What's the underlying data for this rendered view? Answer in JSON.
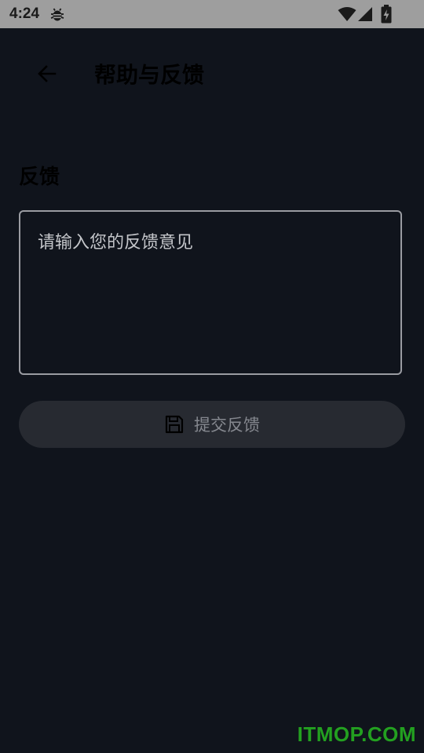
{
  "status_bar": {
    "time": "4:24",
    "icons": [
      "bug-icon",
      "wifi-icon",
      "signal-icon",
      "battery-charging-icon"
    ]
  },
  "app_bar": {
    "back_icon": "arrow-left-icon",
    "title": "帮助与反馈"
  },
  "feedback": {
    "section_title": "反馈",
    "placeholder": "请输入您的反馈意见",
    "value": ""
  },
  "submit": {
    "icon": "save-icon",
    "label": "提交反馈"
  },
  "watermark": "ITMOP.COM",
  "colors": {
    "background": "#10141c",
    "status_bar": "#9e9e9e",
    "button_bg": "#272a31",
    "button_text": "#85888f",
    "input_border": "#9a9ca2",
    "watermark": "#23a020"
  }
}
